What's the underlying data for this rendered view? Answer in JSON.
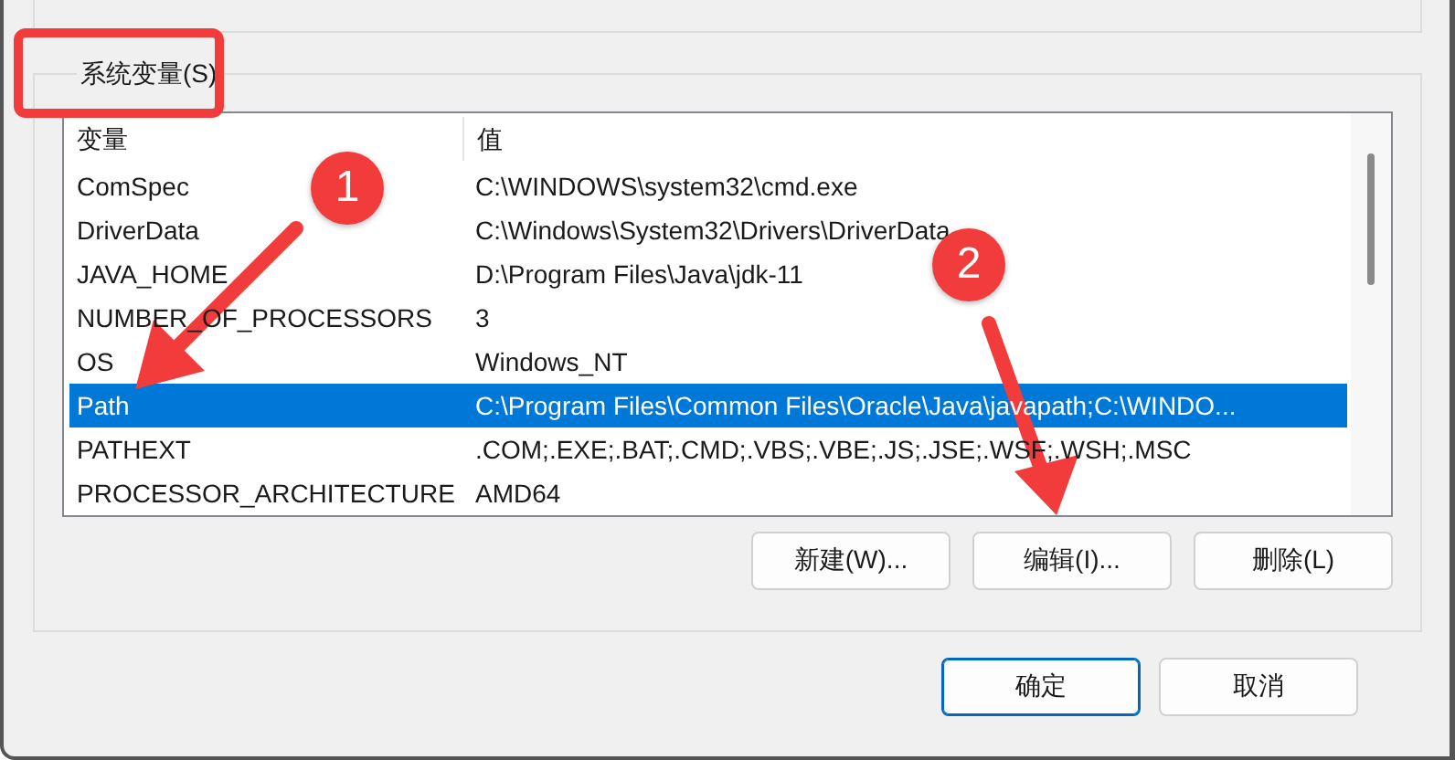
{
  "group": {
    "label": "系统变量(S)"
  },
  "table": {
    "columns": [
      "变量",
      "值"
    ],
    "rows": [
      {
        "name": "ComSpec",
        "value": "C:\\WINDOWS\\system32\\cmd.exe",
        "selected": false
      },
      {
        "name": "DriverData",
        "value": "C:\\Windows\\System32\\Drivers\\DriverData",
        "selected": false
      },
      {
        "name": "JAVA_HOME",
        "value": "D:\\Program Files\\Java\\jdk-11",
        "selected": false
      },
      {
        "name": "NUMBER_OF_PROCESSORS",
        "value": "3",
        "selected": false
      },
      {
        "name": "OS",
        "value": "Windows_NT",
        "selected": false
      },
      {
        "name": "Path",
        "value": "C:\\Program Files\\Common Files\\Oracle\\Java\\javapath;C:\\WINDO...",
        "selected": true
      },
      {
        "name": "PATHEXT",
        "value": ".COM;.EXE;.BAT;.CMD;.VBS;.VBE;.JS;.JSE;.WSF;.WSH;.MSC",
        "selected": false
      },
      {
        "name": "PROCESSOR_ARCHITECTURE",
        "value": "AMD64",
        "selected": false
      }
    ]
  },
  "group_buttons": [
    {
      "label": "新建(W)..."
    },
    {
      "label": "编辑(I)..."
    },
    {
      "label": "删除(L)"
    }
  ],
  "dialog_buttons": [
    {
      "label": "确定",
      "kind": "default"
    },
    {
      "label": "取消",
      "kind": "normal"
    }
  ],
  "annotations": [
    {
      "label": "1"
    },
    {
      "label": "2"
    }
  ]
}
